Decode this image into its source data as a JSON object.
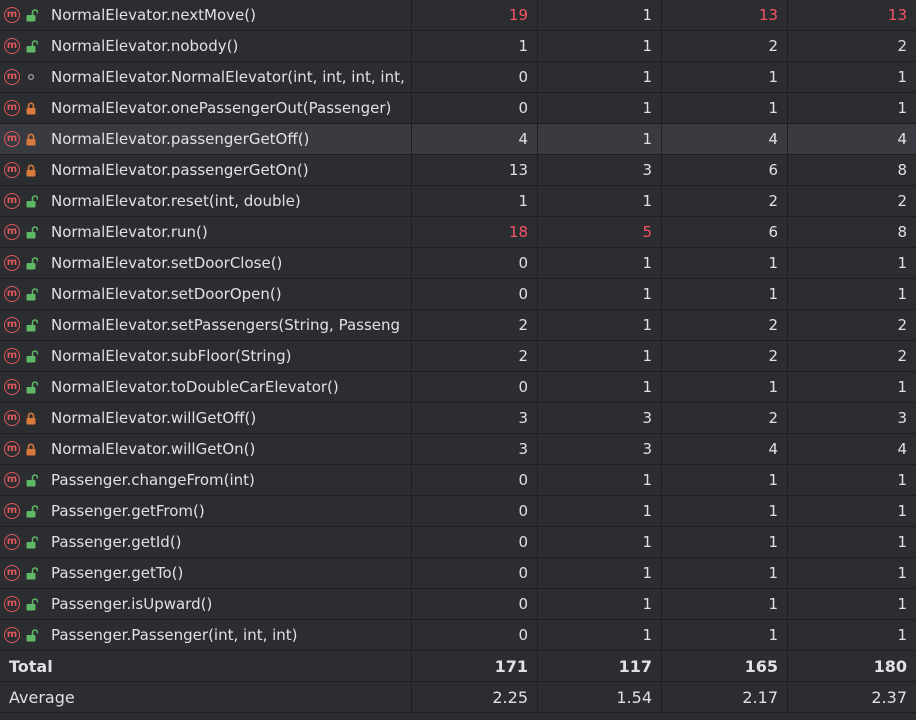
{
  "rows": [
    {
      "name": "NormalElevator.nextMove()",
      "vis": "public",
      "v": [
        "19",
        "1",
        "13",
        "13"
      ],
      "red": [
        true,
        false,
        true,
        true
      ]
    },
    {
      "name": "NormalElevator.nobody()",
      "vis": "public",
      "v": [
        "1",
        "1",
        "2",
        "2"
      ],
      "red": [
        false,
        false,
        false,
        false
      ]
    },
    {
      "name": "NormalElevator.NormalElevator(int, int, int, int,",
      "vis": "package",
      "v": [
        "0",
        "1",
        "1",
        "1"
      ],
      "red": [
        false,
        false,
        false,
        false
      ]
    },
    {
      "name": "NormalElevator.onePassengerOut(Passenger)",
      "vis": "private",
      "v": [
        "0",
        "1",
        "1",
        "1"
      ],
      "red": [
        false,
        false,
        false,
        false
      ]
    },
    {
      "name": "NormalElevator.passengerGetOff()",
      "vis": "private",
      "v": [
        "4",
        "1",
        "4",
        "4"
      ],
      "red": [
        false,
        false,
        false,
        false
      ],
      "selected": true
    },
    {
      "name": "NormalElevator.passengerGetOn()",
      "vis": "private",
      "v": [
        "13",
        "3",
        "6",
        "8"
      ],
      "red": [
        false,
        false,
        false,
        false
      ]
    },
    {
      "name": "NormalElevator.reset(int, double)",
      "vis": "public",
      "v": [
        "1",
        "1",
        "2",
        "2"
      ],
      "red": [
        false,
        false,
        false,
        false
      ]
    },
    {
      "name": "NormalElevator.run()",
      "vis": "public",
      "v": [
        "18",
        "5",
        "6",
        "8"
      ],
      "red": [
        true,
        true,
        false,
        false
      ]
    },
    {
      "name": "NormalElevator.setDoorClose()",
      "vis": "public",
      "v": [
        "0",
        "1",
        "1",
        "1"
      ],
      "red": [
        false,
        false,
        false,
        false
      ]
    },
    {
      "name": "NormalElevator.setDoorOpen()",
      "vis": "public",
      "v": [
        "0",
        "1",
        "1",
        "1"
      ],
      "red": [
        false,
        false,
        false,
        false
      ]
    },
    {
      "name": "NormalElevator.setPassengers(String, Passeng",
      "vis": "public",
      "v": [
        "2",
        "1",
        "2",
        "2"
      ],
      "red": [
        false,
        false,
        false,
        false
      ]
    },
    {
      "name": "NormalElevator.subFloor(String)",
      "vis": "public",
      "v": [
        "2",
        "1",
        "2",
        "2"
      ],
      "red": [
        false,
        false,
        false,
        false
      ]
    },
    {
      "name": "NormalElevator.toDoubleCarElevator()",
      "vis": "public",
      "v": [
        "0",
        "1",
        "1",
        "1"
      ],
      "red": [
        false,
        false,
        false,
        false
      ]
    },
    {
      "name": "NormalElevator.willGetOff()",
      "vis": "private",
      "v": [
        "3",
        "3",
        "2",
        "3"
      ],
      "red": [
        false,
        false,
        false,
        false
      ]
    },
    {
      "name": "NormalElevator.willGetOn()",
      "vis": "private",
      "v": [
        "3",
        "3",
        "4",
        "4"
      ],
      "red": [
        false,
        false,
        false,
        false
      ]
    },
    {
      "name": "Passenger.changeFrom(int)",
      "vis": "public",
      "v": [
        "0",
        "1",
        "1",
        "1"
      ],
      "red": [
        false,
        false,
        false,
        false
      ]
    },
    {
      "name": "Passenger.getFrom()",
      "vis": "public",
      "v": [
        "0",
        "1",
        "1",
        "1"
      ],
      "red": [
        false,
        false,
        false,
        false
      ]
    },
    {
      "name": "Passenger.getId()",
      "vis": "public",
      "v": [
        "0",
        "1",
        "1",
        "1"
      ],
      "red": [
        false,
        false,
        false,
        false
      ]
    },
    {
      "name": "Passenger.getTo()",
      "vis": "public",
      "v": [
        "0",
        "1",
        "1",
        "1"
      ],
      "red": [
        false,
        false,
        false,
        false
      ]
    },
    {
      "name": "Passenger.isUpward()",
      "vis": "public",
      "v": [
        "0",
        "1",
        "1",
        "1"
      ],
      "red": [
        false,
        false,
        false,
        false
      ]
    },
    {
      "name": "Passenger.Passenger(int, int, int)",
      "vis": "public",
      "v": [
        "0",
        "1",
        "1",
        "1"
      ],
      "red": [
        false,
        false,
        false,
        false
      ]
    }
  ],
  "total": {
    "label": "Total",
    "v": [
      "171",
      "117",
      "165",
      "180"
    ]
  },
  "average": {
    "label": "Average",
    "v": [
      "2.25",
      "1.54",
      "2.17",
      "2.37"
    ]
  },
  "icons": {
    "method": "method-icon",
    "method_letter": "m",
    "public": "unlocked-icon",
    "private": "locked-icon",
    "package": "package-dot-icon"
  },
  "colors": {
    "method": "#e0575b",
    "public": "#5fb865",
    "private": "#d9793d",
    "warning": "#f75464"
  }
}
